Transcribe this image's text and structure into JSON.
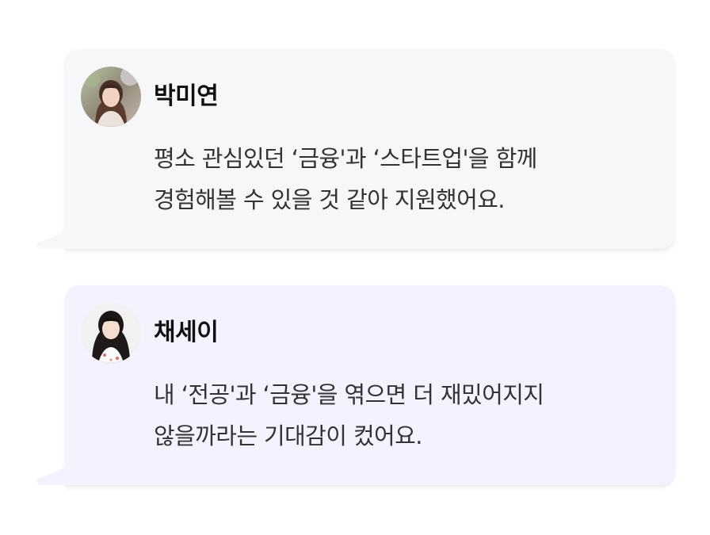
{
  "testimonials": [
    {
      "name": "박미연",
      "avatar_icon": "avatar-photo-icon",
      "lines": [
        "평소 관심있던 ‘금융'과 ‘스타트업'을 함께",
        "경험해볼 수 있을 것 같아 지원했어요."
      ],
      "bubble_color": "#f7f7fa"
    },
    {
      "name": "채세이",
      "avatar_icon": "avatar-photo-icon",
      "lines": [
        "내 ‘전공'과 ‘금융'을 엮으면 더 재밌어지지",
        "않을까라는 기대감이 컸어요."
      ],
      "bubble_color": "#f4f2ff"
    }
  ]
}
